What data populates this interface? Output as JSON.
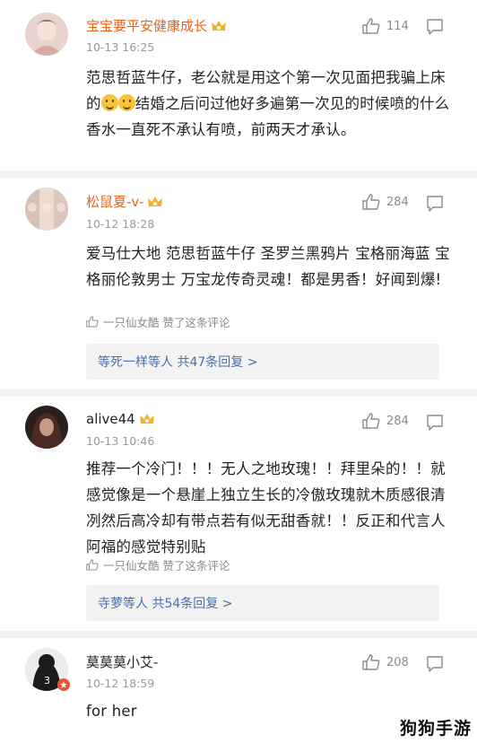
{
  "comments": [
    {
      "username": "宝宝要平安健康成长",
      "time": "10-13 16:25",
      "likes": "114",
      "text_parts": [
        "范思哲蓝牛仔，老公就是用这个第一次见面把我骗上床的",
        "结婚之后问过他好多遍第一次见的时候喷的什么香水一直死不承认有喷，前两天才承认。"
      ]
    },
    {
      "username": "松鼠夏-v-",
      "time": "10-12 18:28",
      "likes": "284",
      "text": "爱马仕大地 范思哲蓝牛仔 圣罗兰黑鸦片 宝格丽海蓝 宝格丽伦敦男士 万宝龙传奇灵魂！都是男香！好闻到爆!",
      "liked_by": "一只仙女酷 赞了这条评论",
      "replies": "等死一样等人 共47条回复 >"
    },
    {
      "username": "alive44",
      "time": "10-13 10:46",
      "likes": "284",
      "text": "推荐一个冷门！！！无人之地玫瑰！！拜里朵的！！就感觉像是一个悬崖上独立生长的冷傲玫瑰就木质感很清冽然后高冷却有带点若有似无甜香就！！反正和代言人 阿福的感觉特别贴",
      "liked_by": "一只仙女酷 赞了这条评论",
      "replies": "寺萝等人 共54条回复 >"
    },
    {
      "username": "莫莫莫小艾-",
      "time": "10-12 18:59",
      "likes": "208",
      "text": "for her"
    }
  ],
  "watermark": "狗狗手游",
  "colors": {
    "vip_name": "#e8631a",
    "reply_link": "#4b6fa6",
    "muted": "#8a8a8a"
  }
}
